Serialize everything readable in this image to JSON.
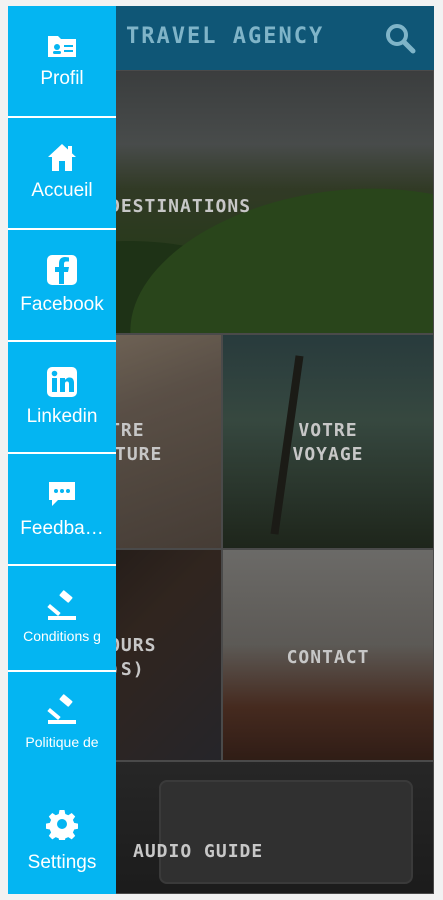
{
  "header": {
    "title": "TRAVEL AGENCY"
  },
  "tiles": {
    "destinations": "DESTINATIONS",
    "aventure_line1": "VOTRE",
    "aventure_line2": "AVENTURE",
    "voyage_line1": "VOTRE",
    "voyage_line2": "VOYAGE",
    "sejours_line1": "SÉJOURS",
    "sejours_line2": "(…)S)",
    "contact": "CONTACT",
    "audio_guide": "AUDIO GUIDE"
  },
  "sidebar": {
    "items": [
      {
        "label": "Profil",
        "icon": "profile-card-icon"
      },
      {
        "label": "Accueil",
        "icon": "home-icon"
      },
      {
        "label": "Facebook",
        "icon": "facebook-icon"
      },
      {
        "label": "Linkedin",
        "icon": "linkedin-icon"
      },
      {
        "label": "Feedba…",
        "icon": "feedback-chat-icon"
      },
      {
        "label": "Conditions g",
        "icon": "gavel-icon"
      },
      {
        "label": "Politique de",
        "icon": "gavel-icon"
      },
      {
        "label": "Settings",
        "icon": "gear-icon"
      }
    ]
  },
  "colors": {
    "sidebar": "#04b5f2",
    "header": "#0f5676",
    "divider": "#ffffff"
  }
}
